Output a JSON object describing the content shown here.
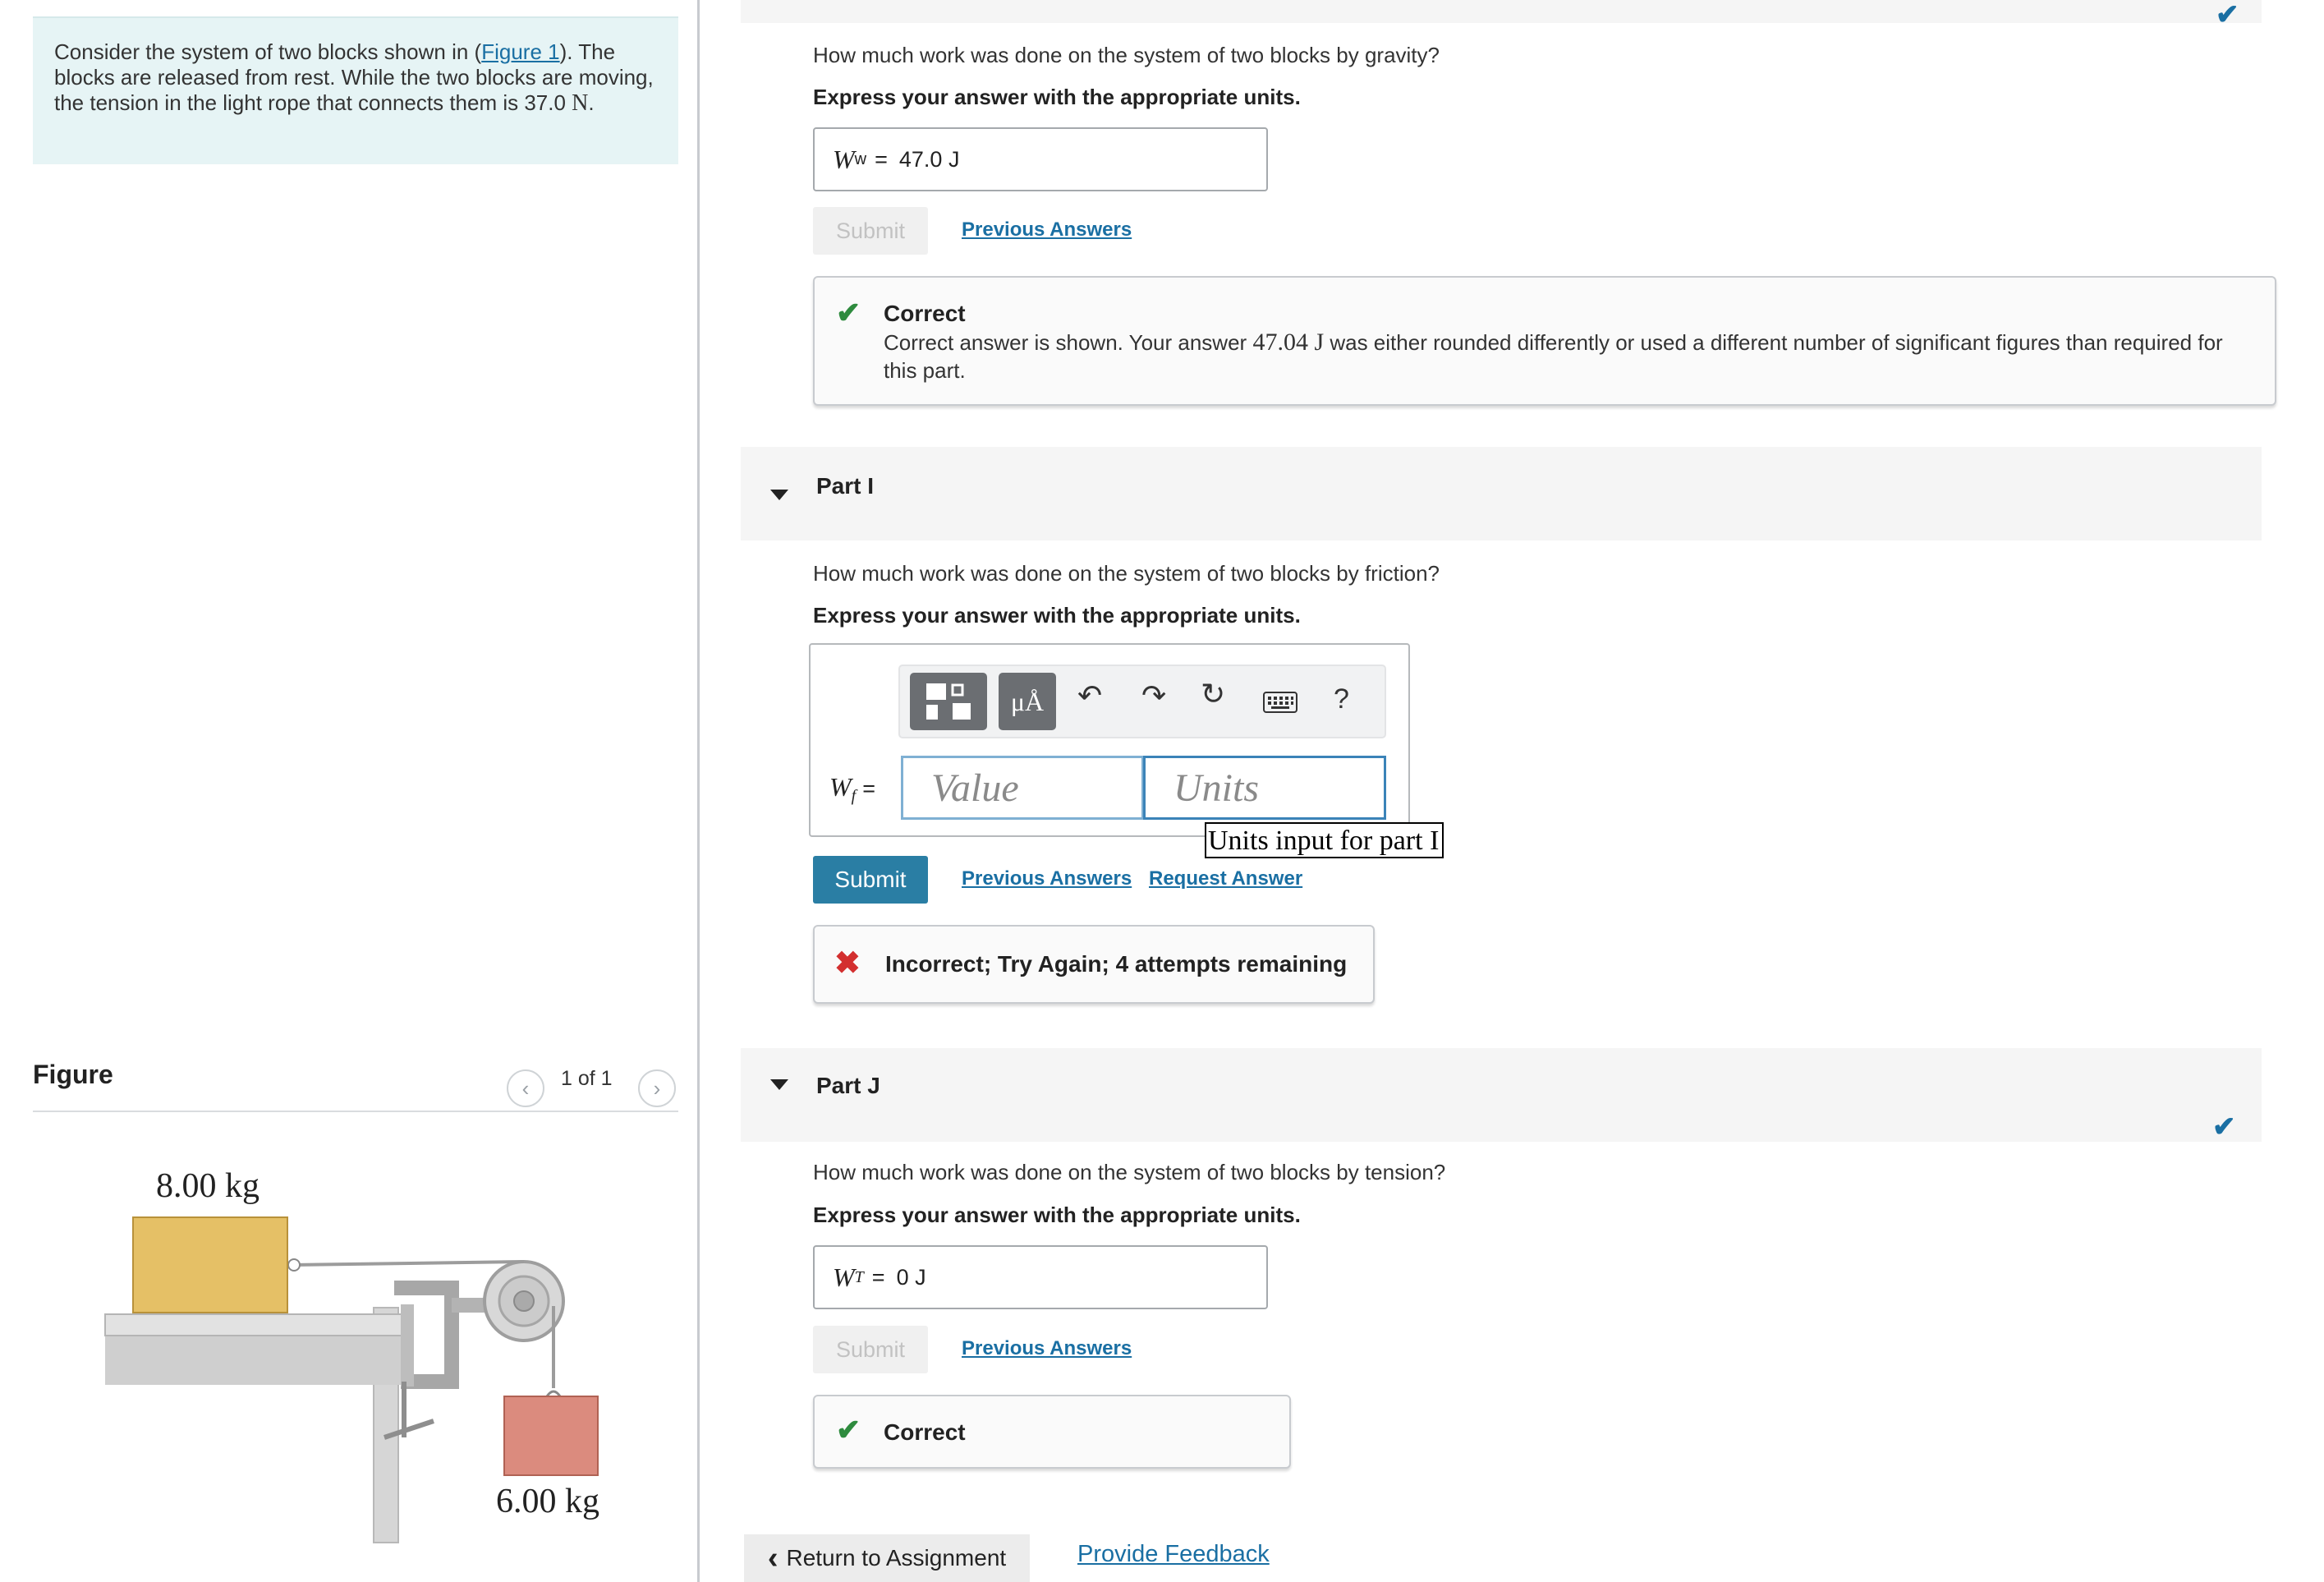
{
  "problem": {
    "text1": "Consider the system of two blocks shown in (",
    "figure_link": "Figure 1",
    "text2": "). The blocks are released from rest. While the two blocks are moving, the tension in the light rope that connects them is 37.0 ",
    "unit": "N",
    "text3": "."
  },
  "figure": {
    "title": "Figure",
    "counter": "1 of 1",
    "mass_top": "8.00 kg",
    "mass_bottom": "6.00 kg",
    "block_top_color": "#e5c066",
    "block_bottom_color": "#db8b7e"
  },
  "part_h": {
    "question": "How much work was done on the system of two blocks by gravity?",
    "instruction": "Express your answer with the appropriate units.",
    "symbol": "W",
    "subscript": "w",
    "answer": "47.0 J",
    "submit": "Submit",
    "previous": "Previous Answers",
    "feedback_title": "Correct",
    "feedback_text1": "Correct answer is shown. Your answer ",
    "feedback_value": "47.04 J",
    "feedback_text2": " was either rounded differently or used a different number of significant figures than required for this part."
  },
  "part_i": {
    "label": "Part I",
    "question": "How much work was done on the system of two blocks by friction?",
    "instruction": "Express your answer with the appropriate units.",
    "symbol": "W",
    "subscript": "f",
    "value_placeholder": "Value",
    "units_placeholder": "Units",
    "tooltip": "Units input for part I",
    "submit": "Submit",
    "previous": "Previous Answers",
    "request": "Request Answer",
    "feedback": "Incorrect; Try Again; 4 attempts remaining",
    "toolbar": {
      "units_symbol": "μÅ",
      "help": "?"
    }
  },
  "part_j": {
    "label": "Part J",
    "question": "How much work was done on the system of two blocks by tension?",
    "instruction": "Express your answer with the appropriate units.",
    "symbol": "W",
    "subscript": "T",
    "answer": "0 J",
    "submit": "Submit",
    "previous": "Previous Answers",
    "feedback_title": "Correct"
  },
  "footer": {
    "return": "Return to Assignment",
    "feedback": "Provide Feedback"
  },
  "colors": {
    "accent": "#2a7ea4",
    "link": "#1a6fa3",
    "correct": "#2e8b3e",
    "incorrect": "#d32f2f"
  }
}
